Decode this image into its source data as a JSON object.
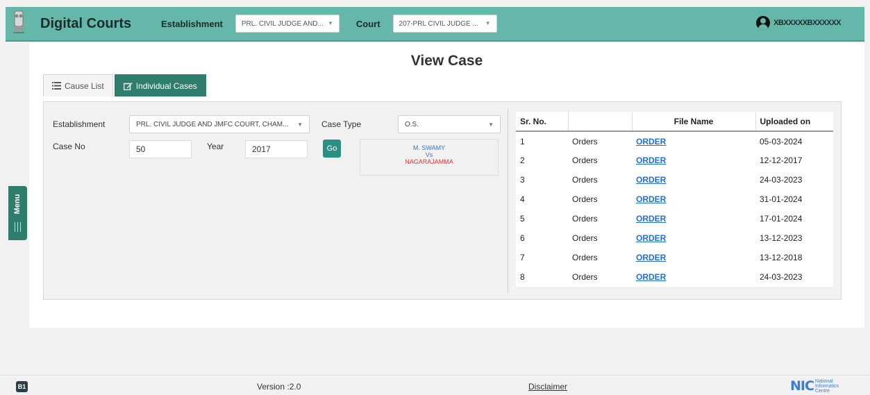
{
  "header": {
    "brand": "Digital Courts",
    "establishment_label": "Establishment",
    "establishment_value": "PRL. CIVIL JUDGE AND...",
    "court_label": "Court",
    "court_value": "207-PRL CIVIL JUDGE ...",
    "user_name": "XBXXXXXBXXXXXX"
  },
  "main": {
    "title": "View Case",
    "tabs": [
      {
        "label": "Cause List",
        "icon": "list-icon",
        "active": false
      },
      {
        "label": "Individual Cases",
        "icon": "edit-icon",
        "active": true
      }
    ],
    "form": {
      "establishment_label": "Establishment",
      "establishment_value": "PRL. CIVIL JUDGE AND JMFC COURT, CHAM...",
      "case_type_label": "Case Type",
      "case_type_value": "O.S.",
      "case_no_label": "Case No",
      "case_no_value": "50",
      "year_label": "Year",
      "year_value": "2017",
      "go_label": "Go"
    },
    "parties": {
      "petitioner": "M. SWAMY",
      "vs": "Vs",
      "respondent": "NAGARAJAMMA"
    },
    "table": {
      "headers": [
        "Sr. No.",
        "",
        "File Name",
        "Uploaded on"
      ],
      "rows": [
        {
          "sr": "1",
          "type": "Orders",
          "file": "ORDER",
          "date": "05-03-2024"
        },
        {
          "sr": "2",
          "type": "Orders",
          "file": "ORDER",
          "date": "12-12-2017"
        },
        {
          "sr": "3",
          "type": "Orders",
          "file": "ORDER",
          "date": "24-03-2023"
        },
        {
          "sr": "4",
          "type": "Orders",
          "file": "ORDER",
          "date": "31-01-2024"
        },
        {
          "sr": "5",
          "type": "Orders",
          "file": "ORDER",
          "date": "17-01-2024"
        },
        {
          "sr": "6",
          "type": "Orders",
          "file": "ORDER",
          "date": "13-12-2023"
        },
        {
          "sr": "7",
          "type": "Orders",
          "file": "ORDER",
          "date": "13-12-2018"
        },
        {
          "sr": "8",
          "type": "Orders",
          "file": "ORDER",
          "date": "24-03-2023"
        }
      ]
    }
  },
  "side_menu": {
    "label": "Menu"
  },
  "footer": {
    "badge": "B1",
    "version": "Version :2.0",
    "disclaimer": "Disclaimer",
    "nic_mark": "NIC",
    "nic_text": [
      "National",
      "Informatics",
      "Centre"
    ]
  },
  "colors": {
    "header_bg": "#64b7a9",
    "accent": "#2f7d6d",
    "link": "#1e6fd9",
    "respondent": "#d83a3a",
    "petitioner": "#3a74c7"
  }
}
